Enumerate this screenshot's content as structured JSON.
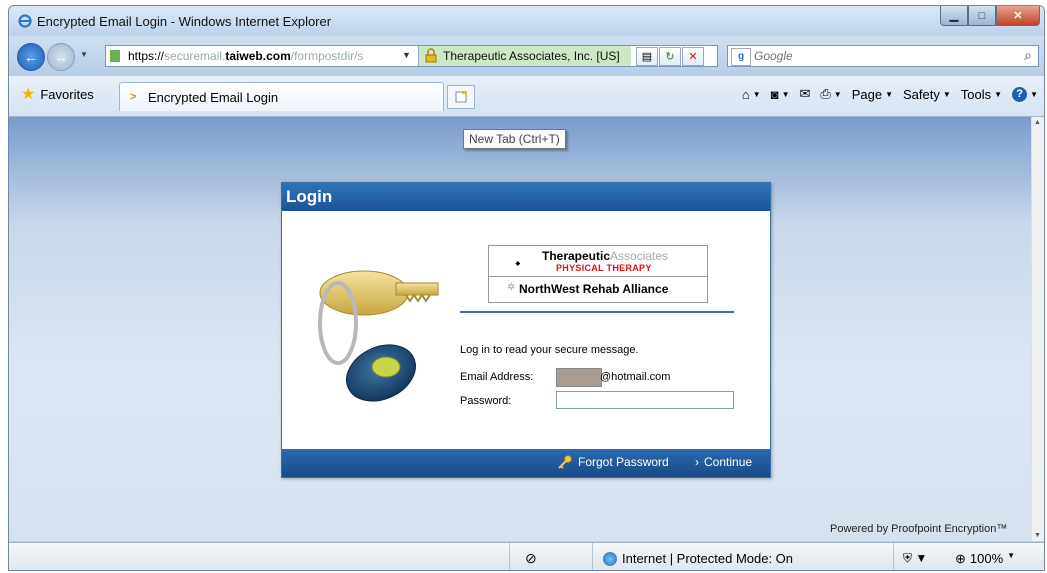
{
  "window": {
    "title": "Encrypted Email Login - Windows Internet Explorer"
  },
  "address": {
    "scheme": "https://",
    "sub": "securemail.",
    "domain": "taiweb.com",
    "path": "/formpostdir/s",
    "security_label": "Therapeutic Associates, Inc. [US]"
  },
  "search": {
    "placeholder": "Google"
  },
  "favorites": {
    "label": "Favorites"
  },
  "tab": {
    "label": "Encrypted Email Login"
  },
  "toolbar": {
    "page": "Page",
    "safety": "Safety",
    "tools": "Tools"
  },
  "tooltip": "New Tab (Ctrl+T)",
  "login": {
    "header": "Login",
    "logo_top_bold": "Therapeutic",
    "logo_top_light": "Associates",
    "logo_sub": "PHYSICAL THERAPY",
    "logo_bottom": "NorthWest Rehab Alliance",
    "intro": "Log in to read your secure message.",
    "email_label": "Email Address:",
    "email_domain": "@hotmail.com",
    "password_label": "Password:",
    "forgot": "Forgot Password",
    "continue": "Continue"
  },
  "footer": {
    "powered": "Powered by Proofpoint Encryption™"
  },
  "status": {
    "zone": "Internet | Protected Mode: On",
    "zoom": "100%"
  },
  "colors": {
    "brand_blue": "#1c5496",
    "logo_red": "#e01010"
  }
}
